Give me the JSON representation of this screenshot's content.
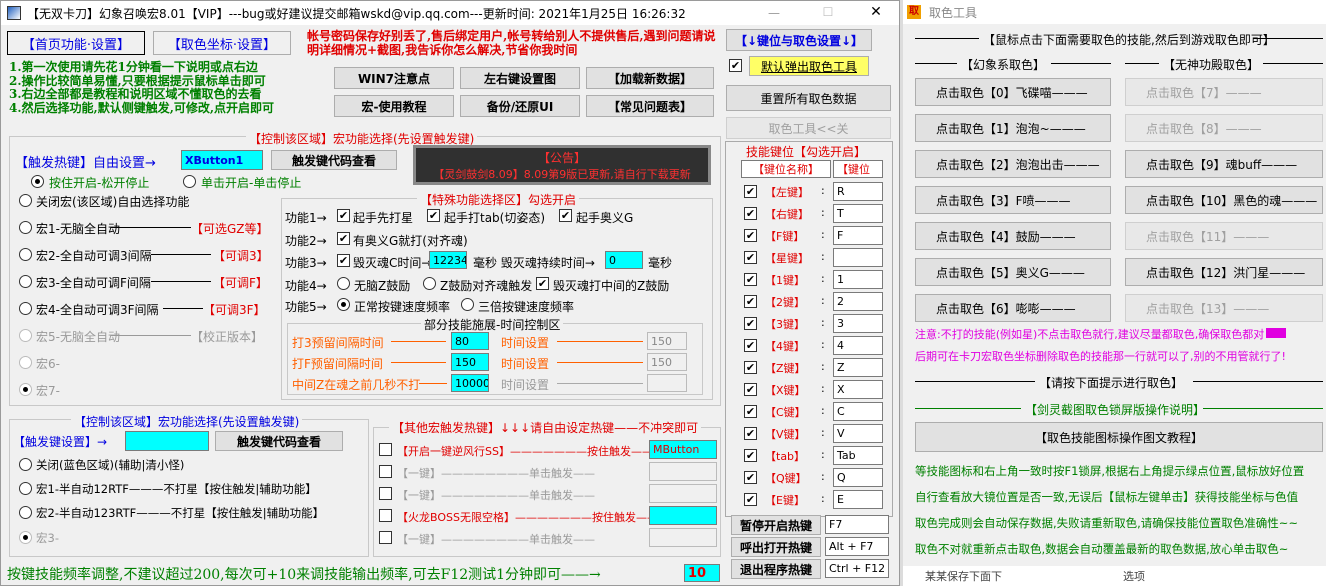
{
  "main": {
    "title": "【无双卡刀】幻象召唤宏8.01【VIP】---bug或好建议提交邮箱wskd@vip.qq.com---更新时间: 2021年1月25日 16:26:32",
    "tab_home": "【首页功能·设置】",
    "tab_coords": "【取色坐标·设置】",
    "warning": "帐号密码保存好别丢了,售后绑定用户,帐号转给别人不提供售后,遇到问题请说明详细情况+截图,我告诉你怎么解决,节省你我时间",
    "steps": [
      "1.第一次使用请先花1分钟看一下说明或点右边",
      "2.操作比较简单易懂,只要根据提示鼠标单击即可",
      "3.右边全部都是教程和说明区域不懂取色的去看",
      "4.然后选择功能,默认侧键触发,可修改,点开启即可"
    ],
    "btn_win7": "WIN7注意点",
    "btn_lr": "左右键设置图",
    "btn_load": "【加载新数据】",
    "btn_tutorial": "宏-使用教程",
    "btn_backup": "备份/还原UI",
    "btn_faq": "【常见问题表】",
    "right_top_btn": "【↓键位与取色设置↓】",
    "auto_popup_label": "默认弹出取色工具",
    "reset_color_btn": "重置所有取色数据",
    "color_tool_close_btn": "取色工具<<关",
    "group1_title": "【控制该区域】宏功能选择(先设置触发键)",
    "hotkey_label": "【触发热键】自由设置→",
    "hotkey_value": "XButton1",
    "hotkey_code_btn": "触发键代码查看",
    "announce_title": "【公告】",
    "announce_text": "【灵剑鼓剑8.09】8.09第9版已更新,请自行下载更新",
    "mode_hold": "按住开启-松开停止",
    "mode_click": "单击开启-单击停止",
    "macros": [
      {
        "label": "关闭宏(该区域)自由选择功能",
        "extra": ""
      },
      {
        "label": "宏1-无脑全自动",
        "extra": "【可选GZ等】"
      },
      {
        "label": "宏2-全自动可调3间隔",
        "extra": "【可调3】"
      },
      {
        "label": "宏3-全自动可调F间隔",
        "extra": "【可调F】"
      },
      {
        "label": "宏4-全自动可调3F间隔",
        "extra": "【可调3F】"
      },
      {
        "label": "宏5-无脑全自动",
        "extra": "【校正版本】"
      },
      {
        "label": "宏6-",
        "extra": ""
      },
      {
        "label": "宏7-",
        "extra": ""
      }
    ],
    "special_title": "【特殊功能选择区】勾选开启",
    "func1": "功能1→",
    "func1_a": "起手先打星",
    "func1_b": "起手打tab(切姿态)",
    "func1_c": "起手奥义G",
    "func2": "功能2→",
    "func2_a": "有奥义G就打(对齐魂)",
    "func3": "功能3→",
    "func3_a": "毁灭魂C时间→",
    "func3_v1": "12234",
    "func3_b": "毫秒 毁灭魂持续时间→",
    "func3_v2": "0",
    "func3_c": "毫秒",
    "func4": "功能4→",
    "func4_a": "无脑Z鼓励",
    "func4_b": "Z鼓励对齐魂触发",
    "func4_c": "毁灭魂打中间的Z鼓励",
    "func5": "功能5→",
    "func5_a": "正常按键速度频率",
    "func5_b": "三倍按键速度频率",
    "timing_title": "部分技能施展-时间控制区",
    "timing": [
      {
        "label": "打3预留间隔时间",
        "value": "80",
        "set": "时间设置",
        "val2": "150"
      },
      {
        "label": "打F预留间隔时间",
        "value": "150",
        "set": "时间设置",
        "val2": "150"
      },
      {
        "label": "中间Z在魂之前几秒不打",
        "value": "10000",
        "set": "时间设置",
        "val2": ""
      }
    ],
    "group2_title": "【控制该区域】宏功能选择(先设置触发键)",
    "hotkey2_label": "【触发键设置】→",
    "hotkey2_code_btn": "触发键代码查看",
    "macros2": [
      "关闭(蓝色区域)(辅助|清小怪)",
      "宏1-半自动12RTF———不打星【按住触发|辅助功能】",
      "宏2-半自动123RTF———不打星【按住触发|辅助功能】",
      "宏3-"
    ],
    "other_title": "【其他宏触发热键】↓↓↓请自由设定热键——不冲突即可",
    "other_rows": [
      {
        "label": "【开启一键逆风行SS】———————按住触发——",
        "value": "MButton",
        "active": true
      },
      {
        "label": "【一键】————————单击触发——",
        "value": "",
        "active": false
      },
      {
        "label": "【一键】————————单击触发——",
        "value": "",
        "active": false
      },
      {
        "label": "【火龙BOSS无限空格】———————按住触发——",
        "value": "",
        "active": true
      },
      {
        "label": "【一键】————————单击触发——",
        "value": "",
        "active": false
      }
    ],
    "bottom_text": "按键技能频率调整,不建议超过200,每次可+10来调技能输出频率,可去F12测试1分钟即可——→",
    "bottom_value": "10",
    "keybind_title": "技能键位【勾选开启】",
    "key_col_name": "【键位名称】",
    "key_col_key": "【键位",
    "keys": [
      {
        "name": "【左键】",
        "key": "R"
      },
      {
        "name": "【右键】",
        "key": "T"
      },
      {
        "name": "【F键】",
        "key": "F"
      },
      {
        "name": "【星键】",
        "key": ""
      },
      {
        "name": "【1键】",
        "key": "1"
      },
      {
        "name": "【2键】",
        "key": "2"
      },
      {
        "name": "【3键】",
        "key": "3"
      },
      {
        "name": "【4键】",
        "key": "4"
      },
      {
        "name": "【Z键】",
        "key": "Z"
      },
      {
        "name": "【X键】",
        "key": "X"
      },
      {
        "name": "【C键】",
        "key": "C"
      },
      {
        "name": "【V键】",
        "key": "V"
      },
      {
        "name": "【tab】",
        "key": "Tab"
      },
      {
        "name": "【Q键】",
        "key": "Q"
      },
      {
        "name": "【E键】",
        "key": "E"
      }
    ],
    "pause_label": "暂停开启热键",
    "pause_value": "F7",
    "callout_label": "呼出打开热键",
    "callout_value": "Alt + F7",
    "exit_label": "退出程序热键",
    "exit_value": "Ctrl + F12"
  },
  "tool": {
    "title": "取色工具",
    "header": "【鼠标点击下面需要取色的技能,然后到游戏取色即可】",
    "left_group": "【幻象系取色】",
    "right_group": "【无神功殿取色】",
    "left_buttons": [
      "点击取色【0】飞碟喵———",
      "点击取色【1】泡泡~———",
      "点击取色【2】泡泡出击———",
      "点击取色【3】F喷———",
      "点击取色【4】鼓励———",
      "点击取色【5】奥义G———",
      "点击取色【6】嘭嘭———"
    ],
    "right_buttons": [
      {
        "label": "点击取色【7】———",
        "enabled": false
      },
      {
        "label": "点击取色【8】———",
        "enabled": false
      },
      {
        "label": "点击取色【9】魂buff———",
        "enabled": true
      },
      {
        "label": "点击取色【10】黑色的魂———",
        "enabled": true
      },
      {
        "label": "点击取色【11】———",
        "enabled": false
      },
      {
        "label": "点击取色【12】洪门星———",
        "enabled": true
      },
      {
        "label": "点击取色【13】———",
        "enabled": false
      }
    ],
    "note1": "注意:不打的技能(例如星)不点击取色就行,建议尽量都取色,确保取色都对",
    "note2": "后期可在卡刀宏取色坐标删除取色的技能那一行就可以了,别的不用管就行了!",
    "progress_header": "【请按下面提示进行取色】",
    "lock_header": "【剑灵截图取色锁屏版操作说明】",
    "tutorial_btn": "【取色技能图标操作图文教程】",
    "help": [
      "等技能图标和右上角一致时按F1锁屏,根据右上角提示绿点位置,鼠标放好位置",
      "自行查看放大镜位置是否一致,无误后【鼠标左键单击】获得技能坐标与色值",
      "取色完成则会自动保存数据,失败请重新取色,请确保技能位置取色准确性~~",
      "取色不对就重新点击取色,数据会自动覆盖最新的取色数据,放心单击取色~"
    ],
    "bg_text": "某某保存下面下",
    "bg_text2": "选项"
  }
}
